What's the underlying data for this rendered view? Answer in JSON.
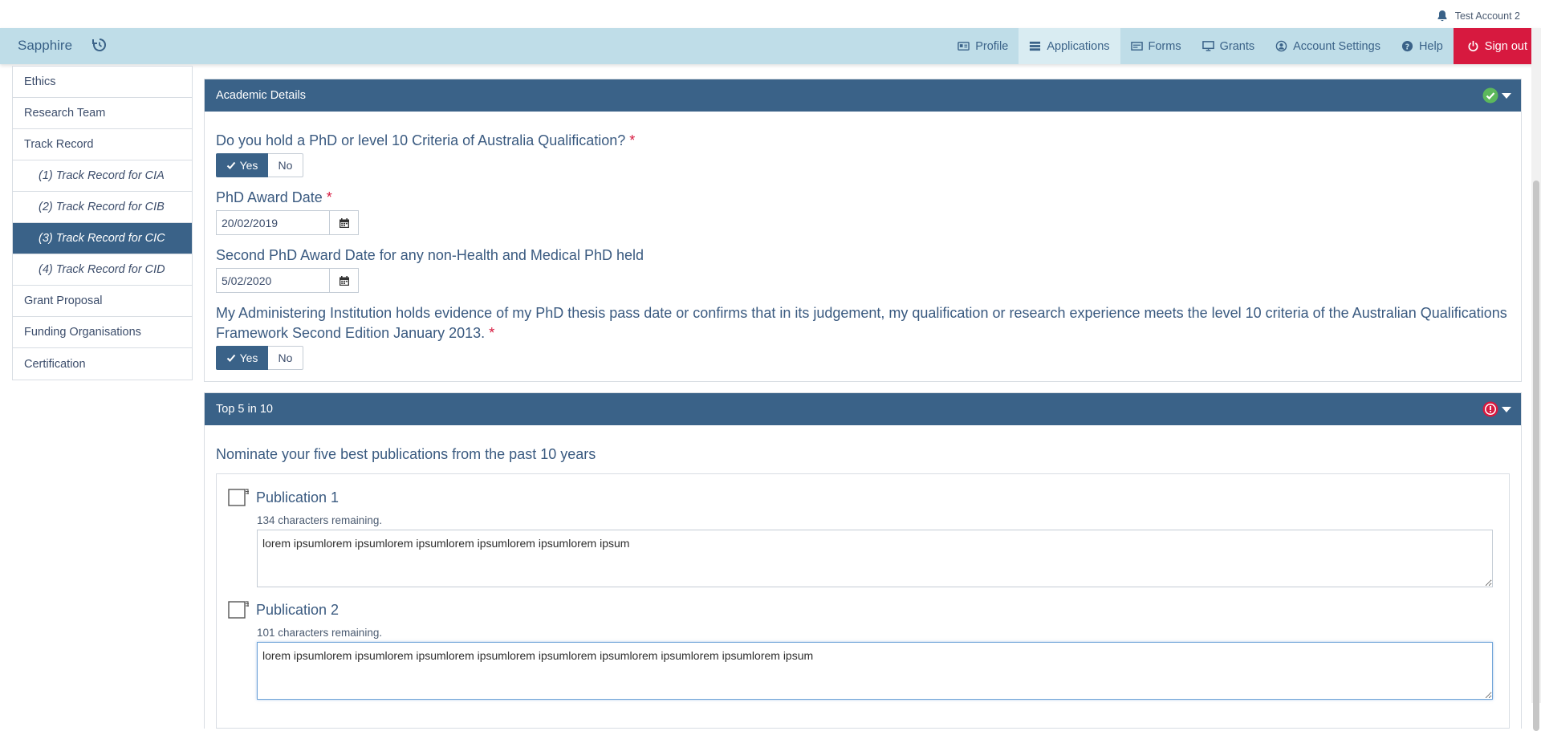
{
  "account": {
    "name": "Test Account 2",
    "icon": "bell-icon"
  },
  "nav": {
    "brand": "Sapphire",
    "items": [
      {
        "label": "Profile",
        "icon": "id-card-icon"
      },
      {
        "label": "Applications",
        "icon": "list-icon",
        "active": true
      },
      {
        "label": "Forms",
        "icon": "form-icon"
      },
      {
        "label": "Grants",
        "icon": "monitor-icon"
      },
      {
        "label": "Account Settings",
        "icon": "user-circle-icon"
      },
      {
        "label": "Help",
        "icon": "question-icon"
      },
      {
        "label": "Sign out",
        "icon": "power-icon"
      }
    ]
  },
  "sidebar": {
    "items": [
      {
        "label": "Ethics"
      },
      {
        "label": "Research Team"
      },
      {
        "label": "Track Record"
      },
      {
        "label": "(1) Track Record for CIA"
      },
      {
        "label": "(2) Track Record for CIB"
      },
      {
        "label": "(3) Track Record for CIC",
        "active": true
      },
      {
        "label": "(4) Track Record for CID"
      },
      {
        "label": "Grant Proposal"
      },
      {
        "label": "Funding Organisations"
      },
      {
        "label": "Certification"
      }
    ]
  },
  "academic": {
    "title": "Academic Details",
    "status": "complete",
    "q1": "Do you hold a PhD or level 10 Criteria of Australia Qualification?",
    "yes": "Yes",
    "no": "No",
    "q2": "PhD Award Date",
    "q2_value": "20/02/2019",
    "q3": "Second PhD Award Date for any non-Health and Medical PhD held",
    "q3_value": "5/02/2020",
    "q4": "My Administering Institution holds evidence of my PhD thesis pass date or confirms that in its judgement, my qualification or research experience meets the level 10 criteria of the Australian Qualifications Framework Second Edition January 2013.",
    "required_mark": "*"
  },
  "top5": {
    "title": "Top 5 in 10",
    "status": "error",
    "intro": "Nominate your five best publications from the past 10 years",
    "publications": [
      {
        "title": "Publication 1",
        "remaining": "134 characters remaining.",
        "text": "lorem ipsumlorem ipsumlorem ipsumlorem ipsumlorem ipsumlorem ipsum"
      },
      {
        "title": "Publication 2",
        "remaining": "101 characters remaining.",
        "text": "lorem ipsumlorem ipsumlorem ipsumlorem ipsumlorem ipsumlorem ipsumlorem ipsumlorem ipsumlorem ipsum"
      }
    ]
  },
  "colors": {
    "accent": "#3a6288",
    "navbar": "#bfdde8",
    "signout": "#d7193f",
    "success": "#5cb85c",
    "error": "#d7193f"
  }
}
